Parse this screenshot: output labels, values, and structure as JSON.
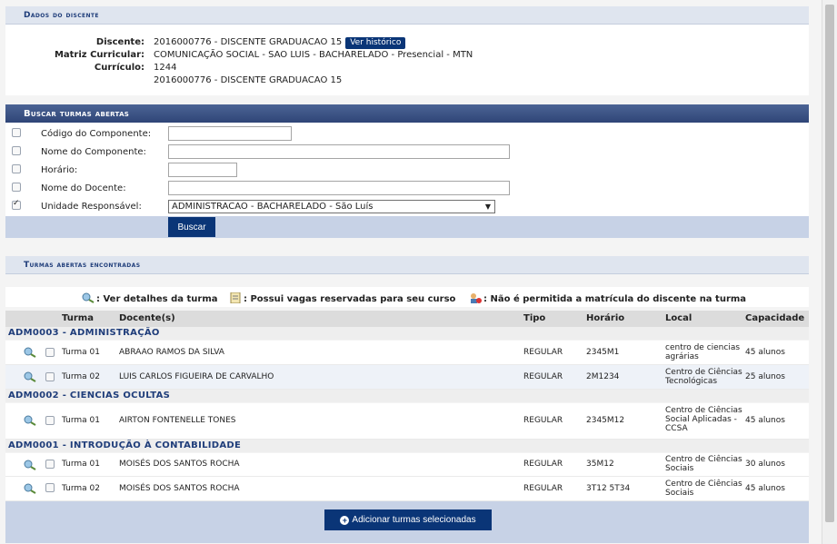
{
  "dados": {
    "title": "Dados do discente",
    "discente_label": "Discente:",
    "discente_value": "2016000776 - DISCENTE GRADUACAO 15",
    "ver_historico": "Ver histórico",
    "matriz_label": "Matriz Curricular:",
    "matriz_value": "COMUNICAÇÃO SOCIAL - SAO LUIS - BACHARELADO - Presencial - MTN",
    "curriculo_label": "Currículo:",
    "curriculo_value": "1244",
    "extra_value": "2016000776 - DISCENTE GRADUACAO 15"
  },
  "busca": {
    "title": "Buscar turmas abertas",
    "fields": [
      {
        "label": "Código do Componente:",
        "checked": false,
        "value": ""
      },
      {
        "label": "Nome do Componente:",
        "checked": false,
        "value": ""
      },
      {
        "label": "Horário:",
        "checked": false,
        "value": ""
      },
      {
        "label": "Nome do Docente:",
        "checked": false,
        "value": ""
      },
      {
        "label": "Unidade Responsável:",
        "checked": true,
        "value": "ADMINISTRACAO - BACHARELADO - São Luís"
      }
    ],
    "buscar_label": "Buscar"
  },
  "resultados": {
    "title": "Turmas abertas encontradas",
    "legend": {
      "detalhes": ": Ver detalhes da turma",
      "vagas": ": Possui vagas reservadas para seu curso",
      "nao_permitida": ": Não é permitida a matrícula do discente na turma"
    },
    "columns": {
      "turma": "Turma",
      "docentes": "Docente(s)",
      "tipo": "Tipo",
      "horario": "Horário",
      "local": "Local",
      "capacidade": "Capacidade"
    },
    "groups": [
      {
        "name": "ADM0003 - ADMINISTRAÇÃO",
        "rows": [
          {
            "turma": "Turma 01",
            "docente": "ABRAAO RAMOS DA SILVA",
            "tipo": "REGULAR",
            "horario": "2345M1",
            "local": "centro de ciencias agrárias",
            "capacidade": "45 alunos"
          },
          {
            "turma": "Turma 02",
            "docente": "LUIS CARLOS FIGUEIRA DE CARVALHO",
            "tipo": "REGULAR",
            "horario": "2M1234",
            "local": "Centro de Ciências Tecnológicas",
            "capacidade": "25 alunos"
          }
        ]
      },
      {
        "name": "ADM0002 - CIENCIAS OCULTAS",
        "rows": [
          {
            "turma": "Turma 01",
            "docente": "AIRTON FONTENELLE TONES",
            "tipo": "REGULAR",
            "horario": "2345M12",
            "local": "Centro de Ciências Social Aplicadas - CCSA",
            "capacidade": "45 alunos"
          }
        ]
      },
      {
        "name": "ADM0001 - INTRODUÇÃO À CONTABILIDADE",
        "rows": [
          {
            "turma": "Turma 01",
            "docente": "MOISÉS DOS SANTOS ROCHA",
            "tipo": "REGULAR",
            "horario": "35M12",
            "local": "Centro de Ciências Sociais",
            "capacidade": "30 alunos"
          },
          {
            "turma": "Turma 02",
            "docente": "MOISÉS DOS SANTOS ROCHA",
            "tipo": "REGULAR",
            "horario": "3T12 5T34",
            "local": "Centro de Ciências Sociais",
            "capacidade": "45 alunos"
          }
        ]
      }
    ],
    "adicionar_label": "Adicionar turmas selecionadas"
  },
  "colors": {
    "primary": "#0a3577",
    "header": "#dfe5ef",
    "footer": "#c7d2e6"
  }
}
